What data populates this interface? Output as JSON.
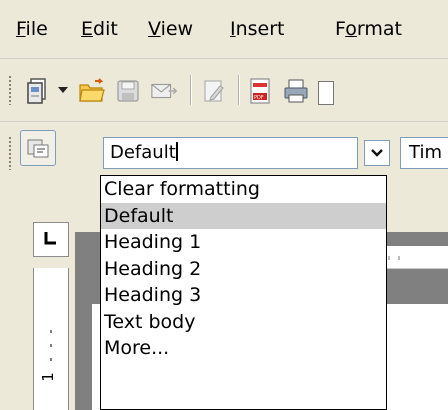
{
  "menubar": {
    "items": [
      {
        "label": "File",
        "mnemonic": "F",
        "rest": "ile"
      },
      {
        "label": "Edit",
        "mnemonic": "E",
        "rest": "dit"
      },
      {
        "label": "View",
        "mnemonic": "V",
        "rest": "iew"
      },
      {
        "label": "Insert",
        "mnemonic": "I",
        "rest": "nsert"
      },
      {
        "label": "Format",
        "pre": "F",
        "mnemonic": "o",
        "rest": "rmat"
      }
    ]
  },
  "toolbar": {
    "icons": [
      "new-document-icon",
      "dropdown-arrow-icon",
      "open-folder-icon",
      "save-icon",
      "email-icon",
      "edit-file-icon",
      "export-pdf-icon",
      "print-icon"
    ]
  },
  "formatting": {
    "style_value": "Default",
    "font_value": "Tim",
    "style_options": [
      "Clear formatting",
      "Default",
      "Heading 1",
      "Heading 2",
      "Heading 3",
      "Text body",
      "More..."
    ],
    "selected_index": 1
  },
  "ruler": {
    "vertical_label": "1"
  },
  "colors": {
    "chrome": "#ece9d8",
    "workspace": "#808080",
    "selection": "#cecece",
    "field_border": "#7f9db9"
  }
}
